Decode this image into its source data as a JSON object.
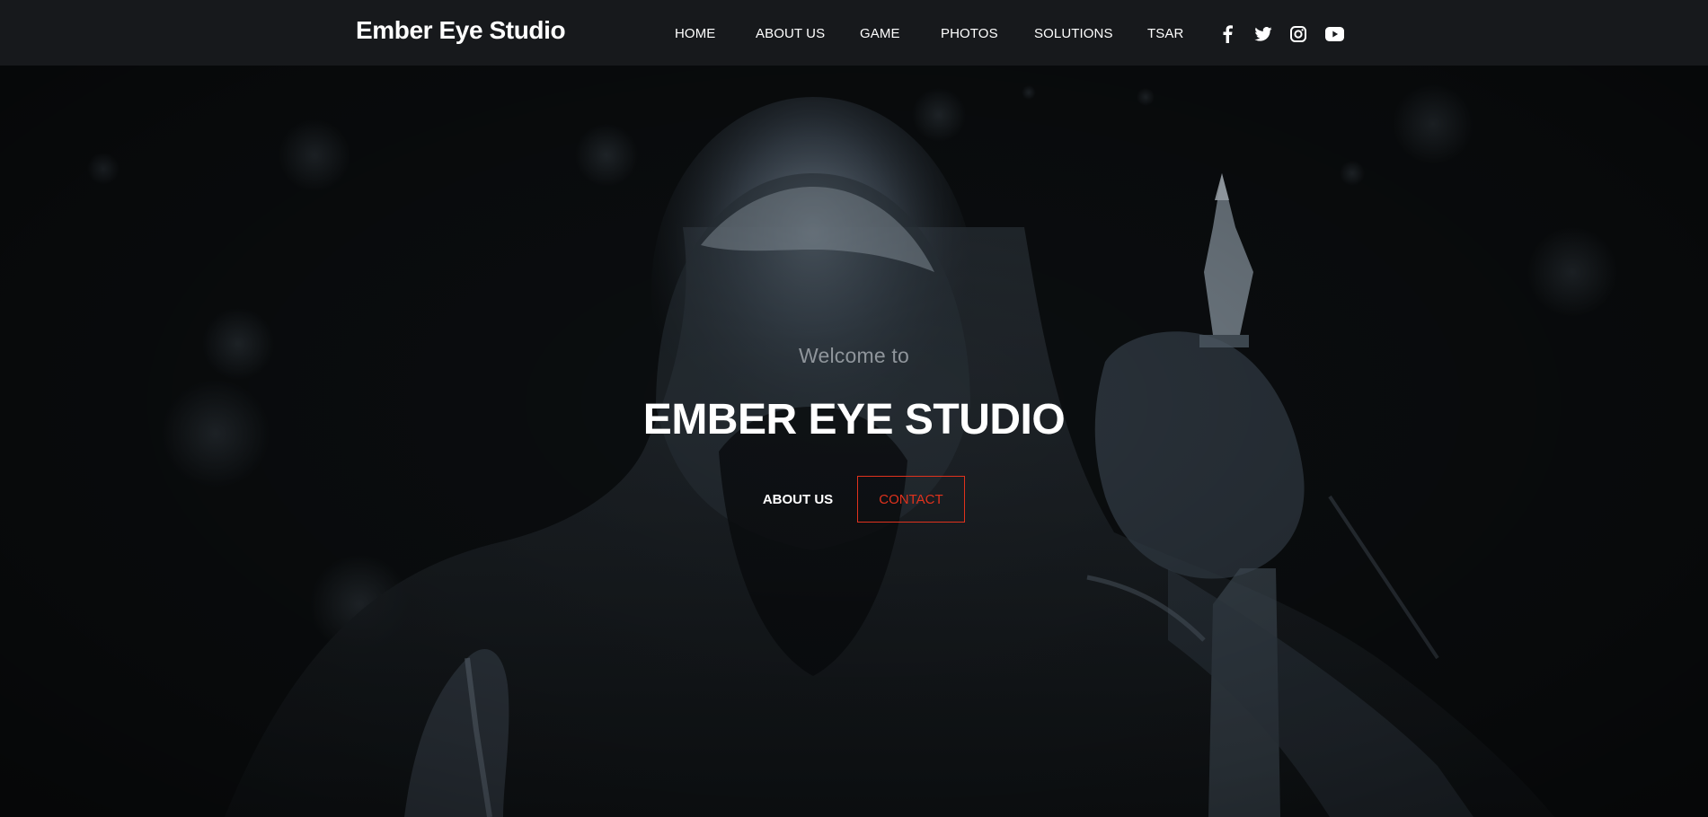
{
  "brand": {
    "name": "Ember Eye Studio"
  },
  "nav": {
    "items": [
      {
        "label": "HOME"
      },
      {
        "label": "ABOUT US"
      },
      {
        "label": "GAME"
      },
      {
        "label": "PHOTOS"
      },
      {
        "label": "SOLUTIONS"
      },
      {
        "label": "TSAR"
      }
    ]
  },
  "social": {
    "icons": [
      "facebook-icon",
      "twitter-icon",
      "instagram-icon",
      "youtube-icon"
    ]
  },
  "hero": {
    "welcome": "Welcome to",
    "title": "EMBER EYE STUDIO",
    "about_button": "ABOUT US",
    "contact_button": "CONTACT"
  },
  "colors": {
    "header_bg": "#17191c",
    "hero_bg": "#0d1012",
    "accent": "#e0321d",
    "text": "#ffffff",
    "muted_text": "#8f959b"
  }
}
